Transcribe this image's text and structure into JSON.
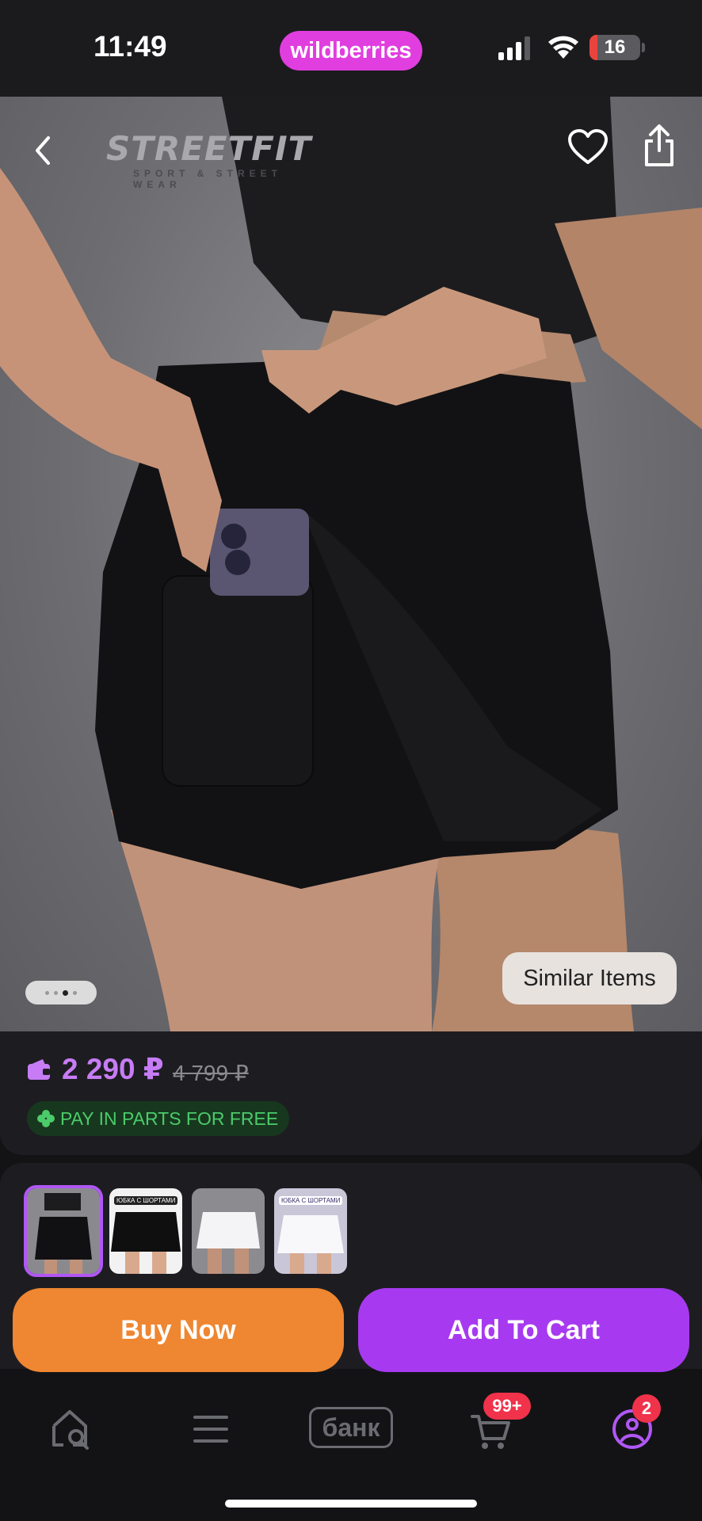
{
  "status_bar": {
    "time": "11:49",
    "brand": "wildberries",
    "battery": "16",
    "battery_level": 0.16,
    "icons": [
      "signal-icon",
      "wifi-icon",
      "battery-icon"
    ]
  },
  "header": {
    "back_icon": "chevron-left-icon",
    "favorite_icon": "heart-icon",
    "share_icon": "share-icon",
    "logo_text": "STREETFIT",
    "logo_tagline": "SPORT & STREET WEAR"
  },
  "gallery": {
    "total_images": 4,
    "active_index": 2,
    "similar_label": "Similar Items"
  },
  "price": {
    "current": "2 290 ₽",
    "old": "4 799 ₽",
    "pay_badge": "PAY IN PARTS FOR FREE",
    "pay_icon": "clover-icon",
    "wallet_icon": "wallet-icon"
  },
  "thumbnails": {
    "selected_index": 0,
    "items": [
      {
        "label": "",
        "variant": "black"
      },
      {
        "label": "ЮБКА С ШОРТАМИ",
        "variant": "black"
      },
      {
        "label": "",
        "variant": "white"
      },
      {
        "label": "ЮБКА С ШОРТАМИ",
        "variant": "white"
      }
    ]
  },
  "actions": {
    "buy_now": "Buy Now",
    "add_to_cart": "Add To Cart"
  },
  "bottom_nav": {
    "home_icon": "home-search-icon",
    "menu_icon": "menu-icon",
    "bank": "банк",
    "cart_icon": "cart-icon",
    "cart_badge": "99+",
    "profile_icon": "profile-icon",
    "profile_badge": "2"
  },
  "colors": {
    "brand": "#e13ee0",
    "price": "#c77cf5",
    "buy_now": "#ef8631",
    "add_to_cart": "#a73af0",
    "pay_badge_text": "#4ccb6a",
    "badge": "#f0324b"
  }
}
